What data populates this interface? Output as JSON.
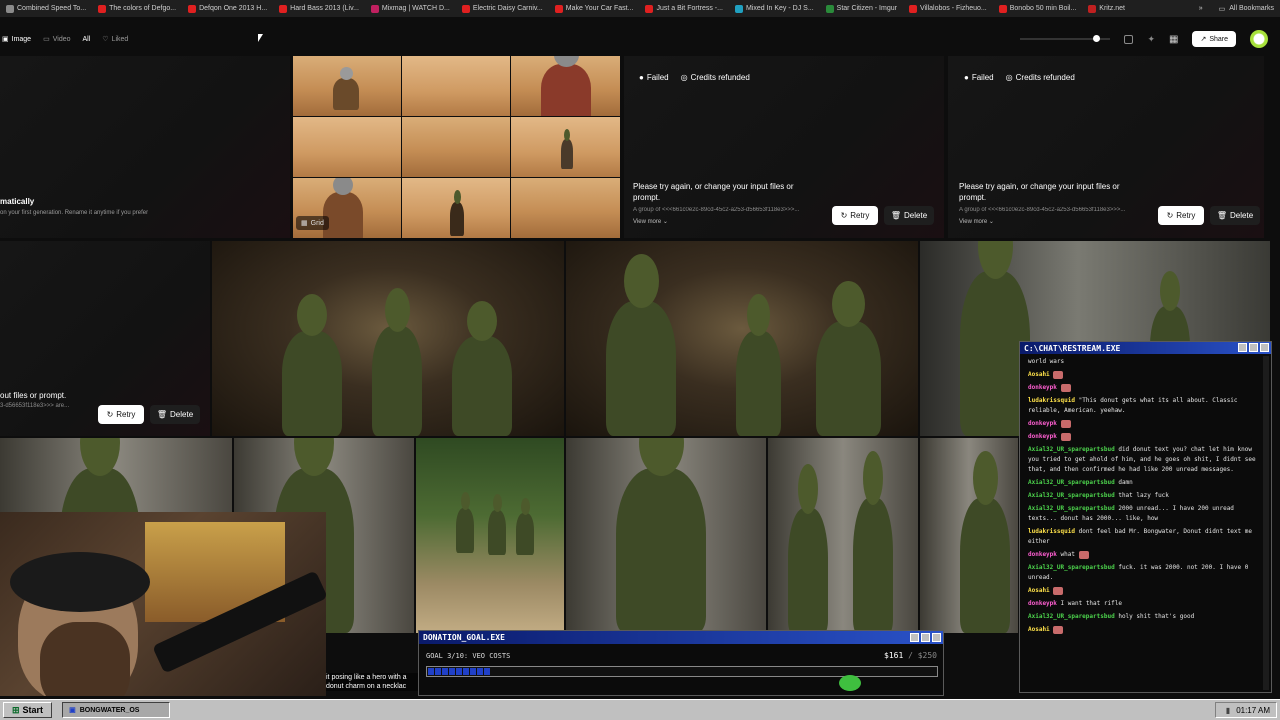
{
  "bookmarks": {
    "items": [
      {
        "label": "Combined Speed To...",
        "color": "#8a8a8a"
      },
      {
        "label": "The colors of Defgo...",
        "color": "#e02020"
      },
      {
        "label": "Defqon One 2013 H...",
        "color": "#e02020"
      },
      {
        "label": "Hard Bass 2013 (Liv...",
        "color": "#e02020"
      },
      {
        "label": "Mixmag | WATCH D...",
        "color": "#c02060"
      },
      {
        "label": "Electric Daisy Carniv...",
        "color": "#e02020"
      },
      {
        "label": "Make Your Car Fast...",
        "color": "#e02020"
      },
      {
        "label": "Just a Bit Fortress -...",
        "color": "#e02020"
      },
      {
        "label": "Mixed In Key - DJ S...",
        "color": "#20a0c0"
      },
      {
        "label": "Star Citizen - Imgur",
        "color": "#2a8a3a"
      },
      {
        "label": "Villalobos - Fizheuo...",
        "color": "#e02020"
      },
      {
        "label": "Bonobo 50 min Boil...",
        "color": "#e02020"
      },
      {
        "label": "Kritz.net",
        "color": "#c02020"
      }
    ],
    "all_bookmarks": "All Bookmarks"
  },
  "toolbar": {
    "image": "Image",
    "video": "Video",
    "all": "All",
    "liked": "Liked",
    "share": "Share"
  },
  "left_card": {
    "title": "matically",
    "sub": "on your first generation. Rename it anytime if you prefer"
  },
  "grid_label": "Grid",
  "failed_cards": [
    {
      "failed": "Failed",
      "refunded": "Credits refunded",
      "message": "Please try again, or change your input files or prompt.",
      "group": "A group of <<<661c0e2c-89cd-45c2-a253-d56653f118e3>>>...",
      "view_more": "View more",
      "retry": "Retry",
      "delete": "Delete"
    },
    {
      "failed": "Failed",
      "refunded": "Credits refunded",
      "message": "Please try again, or change your input files or prompt.",
      "group": "A group of <<<661c0e2c-89cd-45c2-a253-d56653f118e3>>>...",
      "view_more": "View more",
      "retry": "Retry",
      "delete": "Delete"
    }
  ],
  "row2_left": {
    "message": "out files or prompt.",
    "group": "3-d56653f118e3>>> are...",
    "retry": "Retry",
    "delete": "Delete"
  },
  "caption": "it posing like a hero with a donut charm on a necklac",
  "chat": {
    "title": "C:\\CHAT\\RESTREAM.EXE",
    "messages": [
      {
        "user": "",
        "text": "world wars",
        "color": "green"
      },
      {
        "user": "Aosahi",
        "text": "",
        "color": "yellow",
        "emote": true
      },
      {
        "user": "donkeypk",
        "text": "",
        "color": "pink",
        "emote": true
      },
      {
        "user": "ludakrissquid",
        "text": "\"This donut gets what its all about. Classic reliable, American. yeehaw.",
        "color": "yellow"
      },
      {
        "user": "donkeypk",
        "text": "",
        "color": "pink",
        "emote": true
      },
      {
        "user": "donkeypk",
        "text": "",
        "color": "pink",
        "emote": true
      },
      {
        "user": "Axial32_UR_sparepartsbud",
        "text": "did donut text you? chat let him know you tried to get ahold of him, and he goes oh shit, I didnt see that, and then confirmed he had like 200 unread messages.",
        "color": "green"
      },
      {
        "user": "Axial32_UR_sparepartsbud",
        "text": "damn",
        "color": "green"
      },
      {
        "user": "Axial32_UR_sparepartsbud",
        "text": "that lazy fuck",
        "color": "green"
      },
      {
        "user": "Axial32_UR_sparepartsbud",
        "text": "2000 unread... I have 200 unread texts... donut has 2000... like, how",
        "color": "green"
      },
      {
        "user": "ludakrissquid",
        "text": "dont feel bad Mr. Bongwater, Donut didnt text me either",
        "color": "yellow"
      },
      {
        "user": "donkeypk",
        "text": "what",
        "color": "pink",
        "emote": true
      },
      {
        "user": "Axial32_UR_sparepartsbud",
        "text": "fuck. it was 2000. not 200. I have 0 unread.",
        "color": "green"
      },
      {
        "user": "Aosahi",
        "text": "",
        "color": "yellow",
        "emote": true
      },
      {
        "user": "donkeypk",
        "text": "I want that rifle",
        "color": "pink"
      },
      {
        "user": "Axial32_UR_sparepartsbud",
        "text": "holy shit that's good",
        "color": "green"
      },
      {
        "user": "Aosahi",
        "text": "",
        "color": "yellow",
        "emote": true
      }
    ]
  },
  "donation": {
    "title": "DONATION_GOAL.EXE",
    "goal": "GOAL 3/10: VEO COSTS",
    "amount": "$161",
    "max": "/ $250",
    "progress": 0.12
  },
  "taskbar": {
    "start": "Start",
    "task": "BONGWATER_OS",
    "clock": "01:17 AM"
  }
}
